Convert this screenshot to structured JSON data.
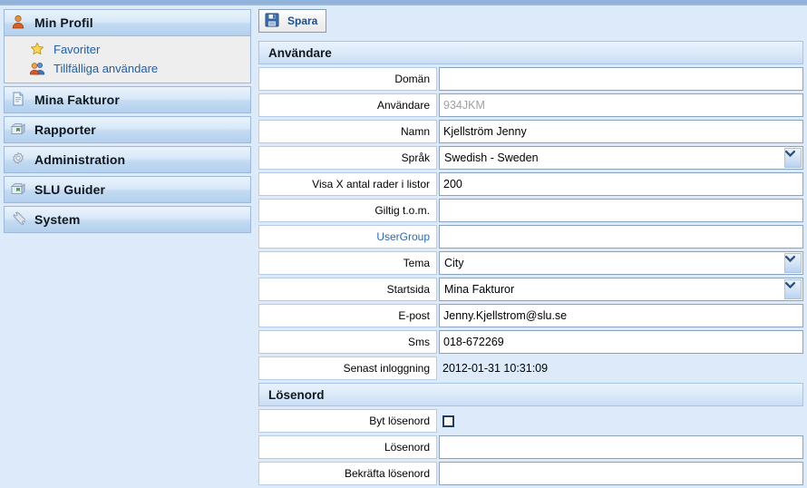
{
  "colors": {
    "page_bg": "#dceaf9",
    "accent_blue": "#1f5fa9",
    "topbar": "#8fb1da",
    "label_link": "#2a6ab5",
    "readonly_text": "#a0a0a0"
  },
  "sidebar": {
    "groups": [
      {
        "label": "Min Profil",
        "icon": "user-icon",
        "expanded": true,
        "items": [
          {
            "label": "Favoriter",
            "icon": "star-icon"
          },
          {
            "label": "Tillfälliga användare",
            "icon": "users-icon"
          }
        ]
      },
      {
        "label": "Mina Fakturor",
        "icon": "document-icon",
        "expanded": false,
        "items": []
      },
      {
        "label": "Rapporter",
        "icon": "reports-icon",
        "expanded": false,
        "items": []
      },
      {
        "label": "Administration",
        "icon": "gear-icon",
        "expanded": false,
        "items": []
      },
      {
        "label": "SLU Guider",
        "icon": "reports-icon",
        "expanded": false,
        "items": []
      },
      {
        "label": "System",
        "icon": "wrench-icon",
        "expanded": false,
        "items": []
      }
    ]
  },
  "toolbar": {
    "save_label": "Spara",
    "save_icon": "floppy-disk-icon"
  },
  "form": {
    "sections": [
      {
        "title": "Användare",
        "rows": [
          {
            "label": "Domän",
            "type": "text",
            "value": "",
            "label_link": false
          },
          {
            "label": "Användare",
            "type": "text",
            "value": "934JKM",
            "readonly": true,
            "label_link": false
          },
          {
            "label": "Namn",
            "type": "text",
            "value": "Kjellström Jenny",
            "label_link": false
          },
          {
            "label": "Språk",
            "type": "select",
            "value": "Swedish - Sweden",
            "label_link": false
          },
          {
            "label": "Visa X antal rader i listor",
            "type": "text",
            "value": "200",
            "label_link": false
          },
          {
            "label": "Giltig t.o.m.",
            "type": "text",
            "value": "",
            "label_link": false
          },
          {
            "label": "UserGroup",
            "type": "text",
            "value": "",
            "label_link": true
          },
          {
            "label": "Tema",
            "type": "select",
            "value": "City",
            "label_link": false
          },
          {
            "label": "Startsida",
            "type": "select",
            "value": "Mina Fakturor",
            "label_link": false
          },
          {
            "label": "E-post",
            "type": "text",
            "value": "Jenny.Kjellstrom@slu.se",
            "label_link": false
          },
          {
            "label": "Sms",
            "type": "text",
            "value": "018-672269",
            "label_link": false
          },
          {
            "label": "Senast inloggning",
            "type": "static",
            "value": "2012-01-31 10:31:09",
            "label_link": false
          }
        ]
      },
      {
        "title": "Lösenord",
        "rows": [
          {
            "label": "Byt lösenord",
            "type": "checkbox",
            "value": "",
            "checked": false,
            "label_link": false
          },
          {
            "label": "Lösenord",
            "type": "text",
            "value": "",
            "label_link": false
          },
          {
            "label": "Bekräfta lösenord",
            "type": "text",
            "value": "",
            "label_link": false
          }
        ]
      }
    ]
  }
}
